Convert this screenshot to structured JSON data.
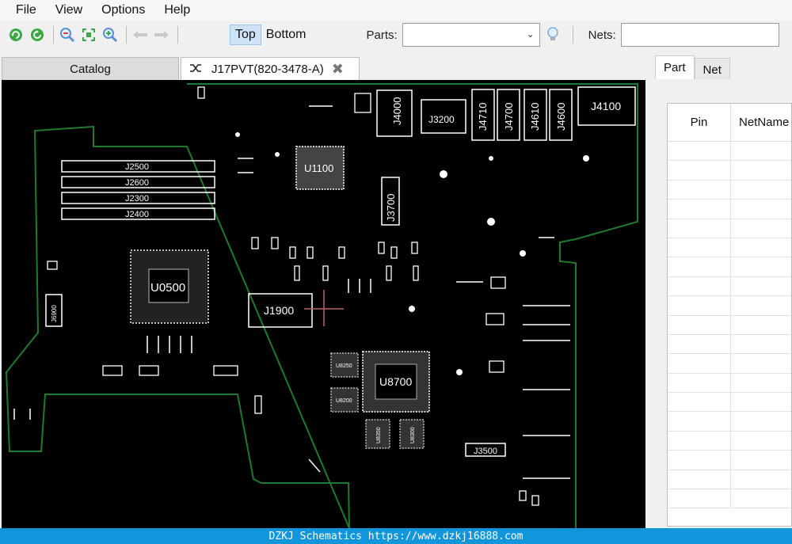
{
  "menu": [
    "File",
    "View",
    "Options",
    "Help"
  ],
  "toolbar": {
    "icons": [
      "refresh-green-icon",
      "rotate-green-icon",
      "zoom-out-icon",
      "zoom-fit-icon",
      "zoom-in-icon",
      "back-arrow-icon",
      "forward-arrow-icon"
    ],
    "top_label": "Top",
    "bottom_label": "Bottom",
    "parts_label": "Parts:",
    "parts_value": "",
    "nets_label": "Nets:",
    "nets_value": ""
  },
  "tabs": {
    "catalog": "Catalog",
    "board": "J17PVT(820-3478-A)"
  },
  "board": {
    "components": [
      "J2500",
      "J2600",
      "J2300",
      "J2400",
      "U0500",
      "J1900",
      "U1100",
      "J3700",
      "J4000",
      "J3200",
      "J4710",
      "J4700",
      "J4610",
      "J4600",
      "J4100",
      "U8700",
      "U8250",
      "U8200",
      "U8350",
      "U8300",
      "J3500",
      "J6900"
    ],
    "colors": {
      "outline": "#1e7a2e",
      "silkscreen": "#ffffff",
      "background": "#000000",
      "crosshair": "#c0606a"
    }
  },
  "rightpane": {
    "tabs": [
      "Part",
      "Net"
    ],
    "columns": [
      "Pin",
      "NetName"
    ],
    "rows": 19
  },
  "status": "DZKJ Schematics https://www.dzkj16888.com"
}
